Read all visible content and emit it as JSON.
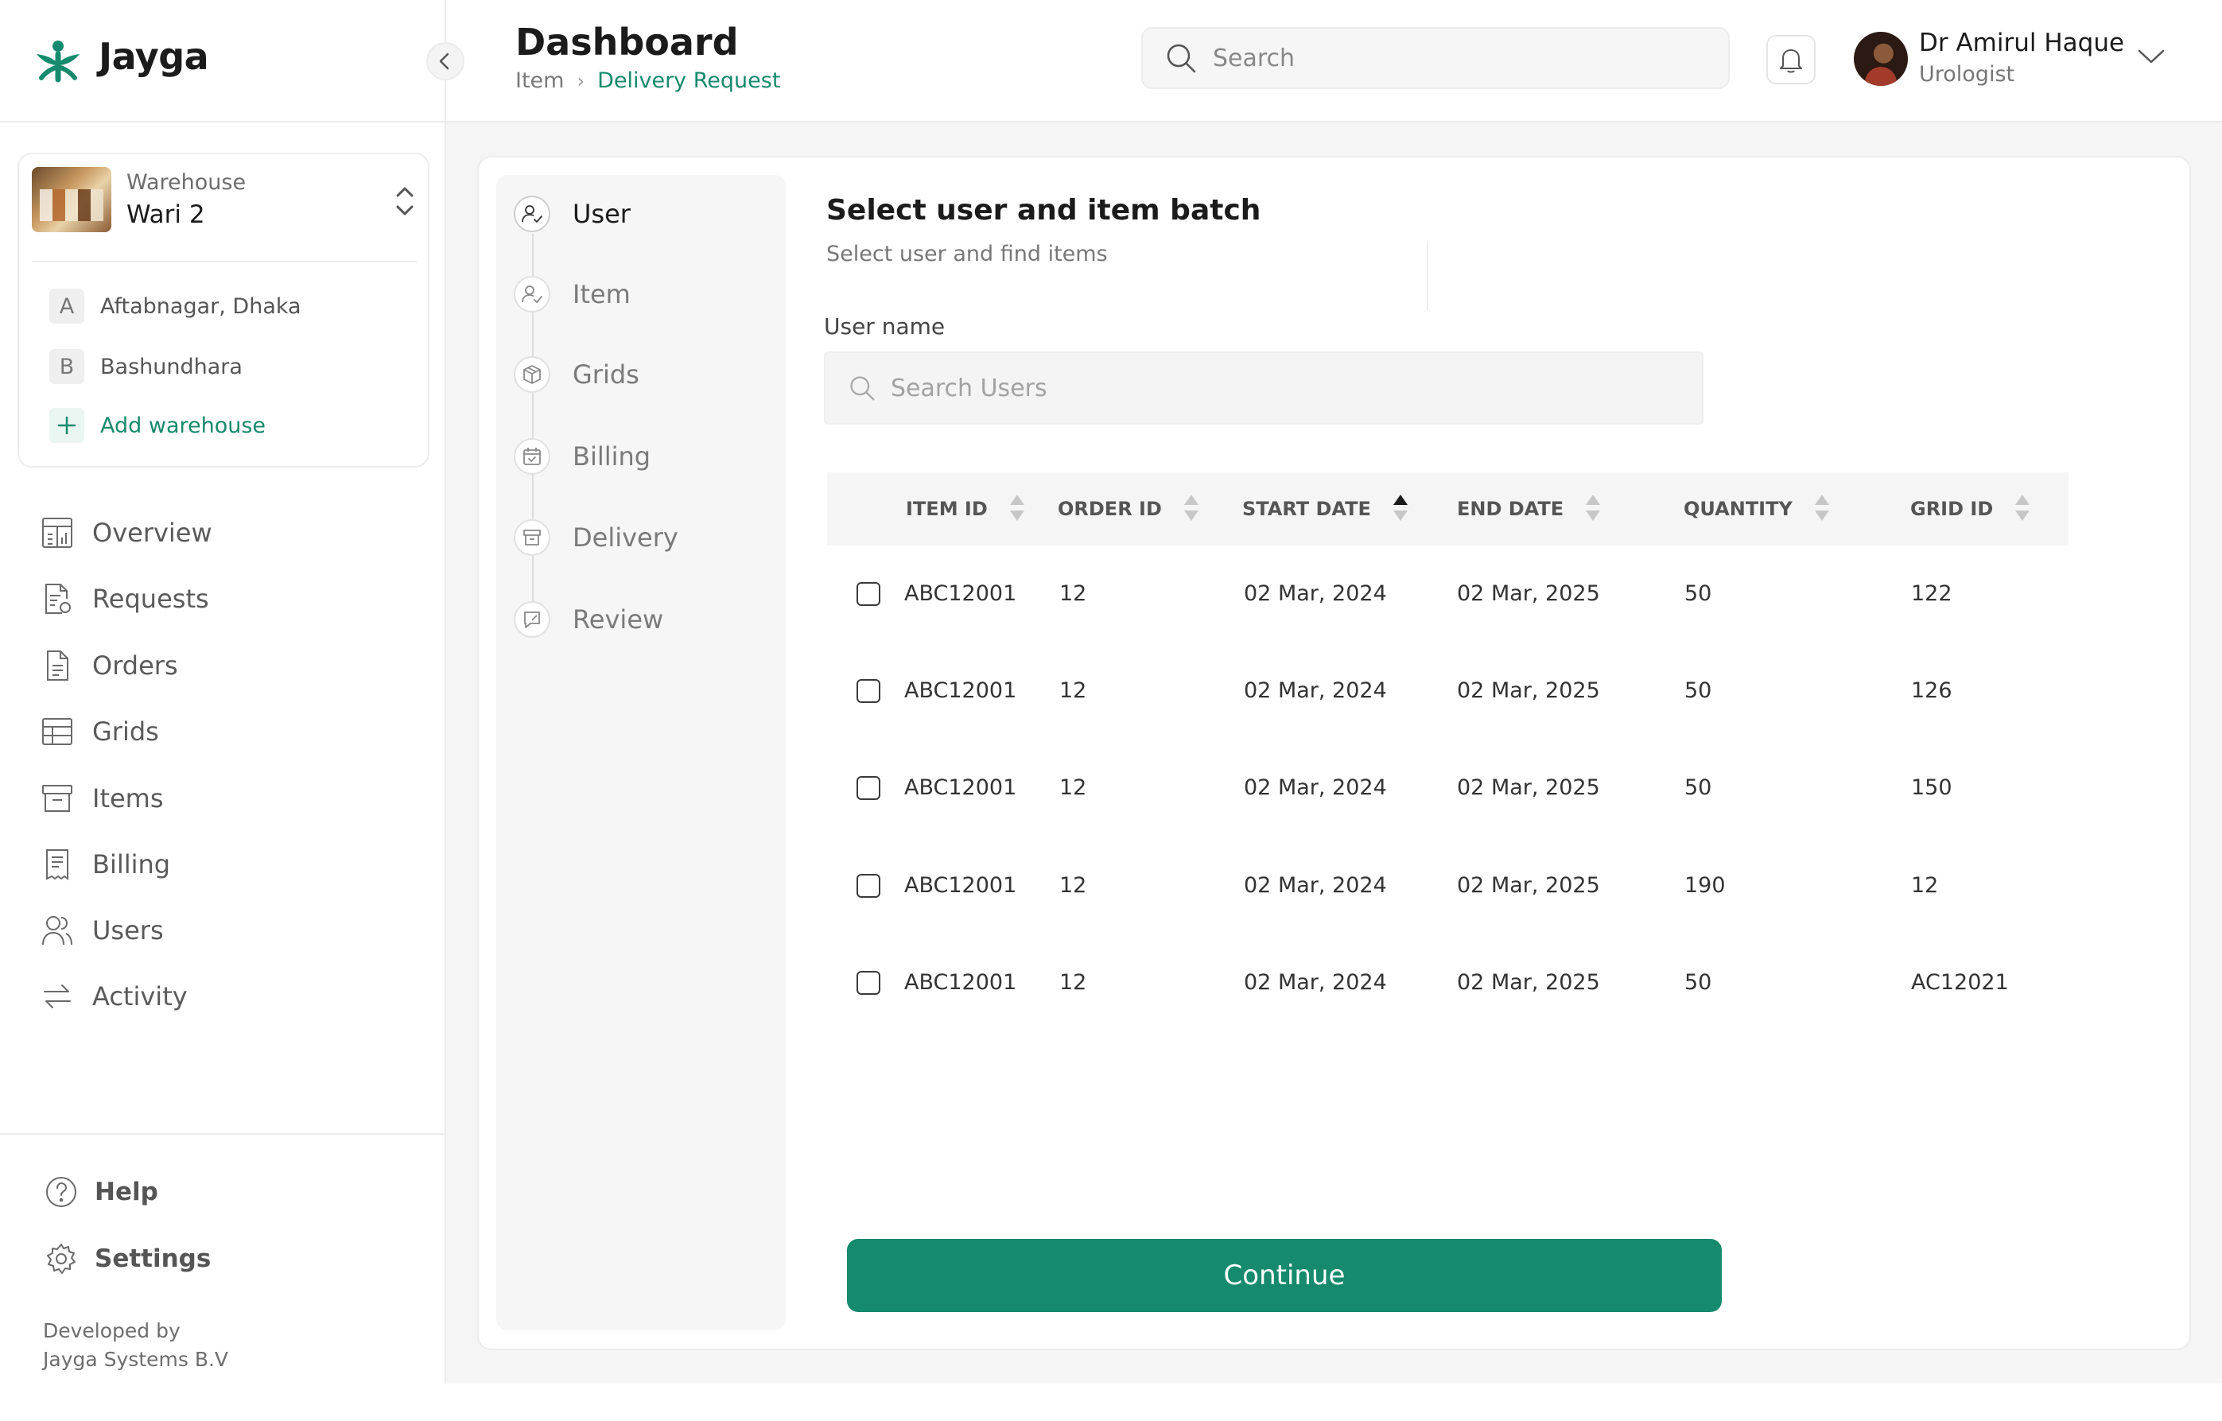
{
  "brand": {
    "name": "Jayga"
  },
  "warehouse": {
    "label": "Warehouse",
    "current": "Wari 2",
    "list": [
      {
        "badge": "A",
        "name": "Aftabnagar, Dhaka"
      },
      {
        "badge": "B",
        "name": "Bashundhara"
      }
    ],
    "add_label": "Add warehouse"
  },
  "nav": [
    {
      "label": "Overview",
      "icon": "overview-icon"
    },
    {
      "label": "Requests",
      "icon": "requests-icon"
    },
    {
      "label": "Orders",
      "icon": "orders-icon"
    },
    {
      "label": "Grids",
      "icon": "grids-icon"
    },
    {
      "label": "Items",
      "icon": "items-icon"
    },
    {
      "label": "Billing",
      "icon": "billing-icon"
    },
    {
      "label": "Users",
      "icon": "users-icon"
    },
    {
      "label": "Activity",
      "icon": "activity-icon"
    }
  ],
  "bottom_nav": {
    "help": "Help",
    "settings": "Settings"
  },
  "footer": {
    "line1": "Developed by",
    "line2": "Jayga Systems B.V"
  },
  "header": {
    "title": "Dashboard",
    "breadcrumb": [
      "Item",
      "Delivery Request"
    ],
    "search_placeholder": "Search",
    "user": {
      "name": "Dr Amirul Haque",
      "role": "Urologist"
    }
  },
  "steps": [
    {
      "label": "User",
      "icon": "user-check-icon",
      "active": true
    },
    {
      "label": "Item",
      "icon": "user-check-icon",
      "active": false
    },
    {
      "label": "Grids",
      "icon": "box-icon",
      "active": false
    },
    {
      "label": "Billing",
      "icon": "calendar-check-icon",
      "active": false
    },
    {
      "label": "Delivery",
      "icon": "store-icon",
      "active": false
    },
    {
      "label": "Review",
      "icon": "review-icon",
      "active": false
    }
  ],
  "form": {
    "title": "Select user and item batch",
    "subtitle": "Select user and find items",
    "user_label": "User name",
    "user_placeholder": "Search Users"
  },
  "table": {
    "columns": [
      "ITEM ID",
      "ORDER ID",
      "START DATE",
      "END DATE",
      "QUANTITY",
      "GRID ID"
    ],
    "sorted_column": "START DATE",
    "rows": [
      [
        "ABC12001",
        "12",
        "02 Mar, 2024",
        "02 Mar, 2025",
        "50",
        "122"
      ],
      [
        "ABC12001",
        "12",
        "02 Mar, 2024",
        "02 Mar, 2025",
        "50",
        "126"
      ],
      [
        "ABC12001",
        "12",
        "02 Mar, 2024",
        "02 Mar, 2025",
        "50",
        "150"
      ],
      [
        "ABC12001",
        "12",
        "02 Mar, 2024",
        "02 Mar, 2025",
        "190",
        "12"
      ],
      [
        "ABC12001",
        "12",
        "02 Mar, 2024",
        "02 Mar, 2025",
        "50",
        "AC12021"
      ]
    ]
  },
  "actions": {
    "continue": "Continue"
  },
  "colors": {
    "accent": "#168a6c",
    "accent_light": "#eaf6f1"
  }
}
